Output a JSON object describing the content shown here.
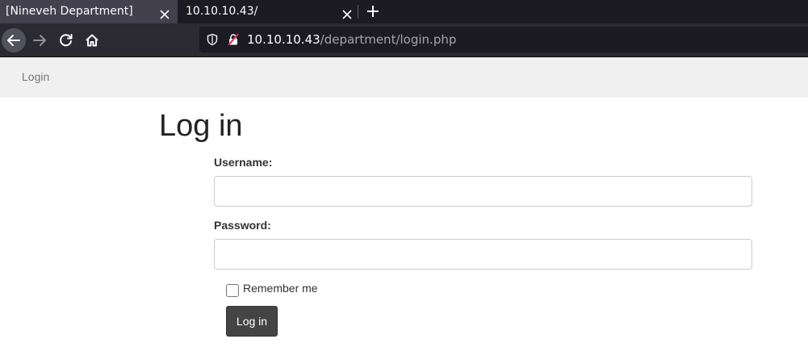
{
  "browser": {
    "tabs": [
      {
        "title": "[Nineveh Department]",
        "active": true
      },
      {
        "title": "10.10.10.43/",
        "active": false
      }
    ],
    "url": {
      "host": "10.10.10.43",
      "path": "/department/login.php"
    },
    "colors": {
      "tab_strip": "#1c1b22",
      "active_tab": "#42414d",
      "toolbar": "#2b2a33",
      "urlbar": "#1c1b22"
    }
  },
  "page": {
    "nav": {
      "login_link": "Login"
    },
    "title": "Log in",
    "form": {
      "username_label": "Username:",
      "username_value": "",
      "password_label": "Password:",
      "password_value": "",
      "remember_label": "Remember me",
      "remember_checked": false,
      "submit_label": "Log in"
    },
    "colors": {
      "nav_bg": "#f0f0f0",
      "button_bg": "#444444",
      "heading": "#222222"
    }
  }
}
